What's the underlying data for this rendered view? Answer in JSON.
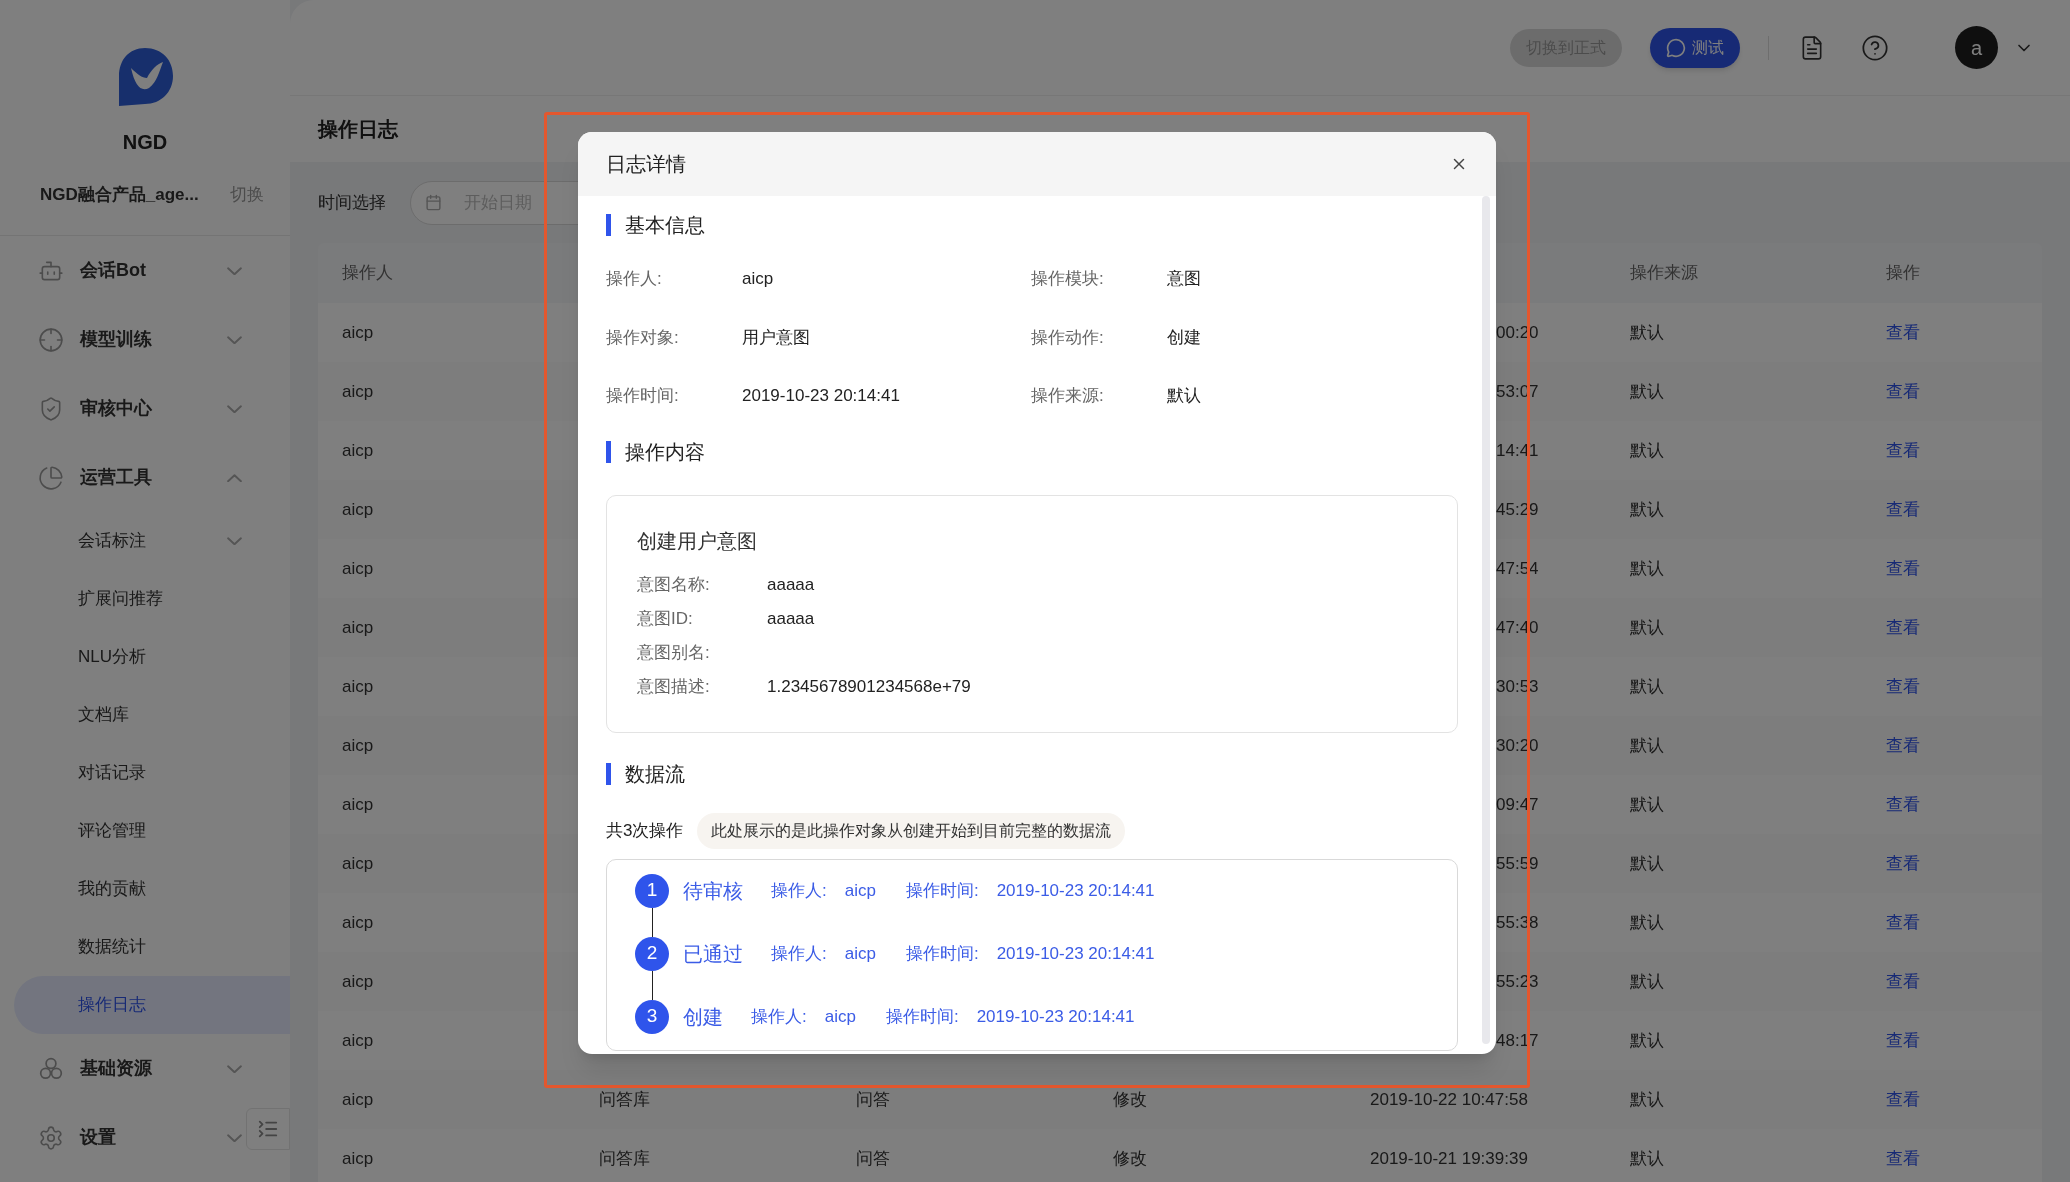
{
  "sidebar": {
    "logo_text": "NGD",
    "project": "NGD融合产品_age...",
    "switch_link": "切换",
    "menu": [
      {
        "label": "会话Bot",
        "expanded": false
      },
      {
        "label": "模型训练",
        "expanded": false
      },
      {
        "label": "审核中心",
        "expanded": false
      },
      {
        "label": "运营工具",
        "expanded": true,
        "children": [
          {
            "kind": "submenu",
            "label": "会话标注",
            "expanded": false,
            "selected": false
          },
          {
            "kind": "link",
            "label": "扩展问推荐",
            "selected": false
          },
          {
            "kind": "link",
            "label": "NLU分析",
            "selected": false
          },
          {
            "kind": "link",
            "label": "文档库",
            "selected": false
          },
          {
            "kind": "link",
            "label": "对话记录",
            "selected": false
          },
          {
            "kind": "link",
            "label": "评论管理",
            "selected": false
          },
          {
            "kind": "link",
            "label": "我的贡献",
            "selected": false
          },
          {
            "kind": "link",
            "label": "数据统计",
            "selected": false
          },
          {
            "kind": "link",
            "label": "操作日志",
            "selected": true
          }
        ]
      },
      {
        "label": "基础资源",
        "expanded": false
      },
      {
        "label": "设置",
        "expanded": false
      }
    ]
  },
  "topbar": {
    "env_button": "切换到正式",
    "test_button": "测试",
    "avatar": "a"
  },
  "page": {
    "title": "操作日志",
    "filter_label": "时间选择",
    "date_placeholder": "开始日期"
  },
  "table": {
    "columns": {
      "operator": "操作人",
      "source": "操作来源",
      "action": "操作"
    },
    "rows": [
      {
        "operator": "aicp",
        "time": "00:20",
        "source": "默认",
        "action": "查看"
      },
      {
        "operator": "aicp",
        "time": "53:07",
        "source": "默认",
        "action": "查看"
      },
      {
        "operator": "aicp",
        "time": "14:41",
        "source": "默认",
        "action": "查看"
      },
      {
        "operator": "aicp",
        "time": "45:29",
        "source": "默认",
        "action": "查看"
      },
      {
        "operator": "aicp",
        "time": "47:54",
        "source": "默认",
        "action": "查看"
      },
      {
        "operator": "aicp",
        "time": "47:40",
        "source": "默认",
        "action": "查看"
      },
      {
        "operator": "aicp",
        "time": "30:53",
        "source": "默认",
        "action": "查看"
      },
      {
        "operator": "aicp",
        "time": "30:20",
        "source": "默认",
        "action": "查看"
      },
      {
        "operator": "aicp",
        "time": "09:47",
        "source": "默认",
        "action": "查看"
      },
      {
        "operator": "aicp",
        "time": "55:59",
        "source": "默认",
        "action": "查看"
      },
      {
        "operator": "aicp",
        "time": "55:38",
        "source": "默认",
        "action": "查看"
      },
      {
        "operator": "aicp",
        "time": "55:23",
        "source": "默认",
        "action": "查看"
      },
      {
        "operator": "aicp",
        "time": "48:17",
        "source": "默认",
        "action": "查看"
      },
      {
        "operator": "aicp",
        "module": "问答库",
        "object": "问答",
        "type": "修改",
        "time": "2019-10-22 10:47:58",
        "source": "默认",
        "action": "查看"
      },
      {
        "operator": "aicp",
        "module": "问答库",
        "object": "问答",
        "type": "修改",
        "time": "2019-10-21 19:39:39",
        "source": "默认",
        "action": "查看"
      }
    ]
  },
  "modal": {
    "title": "日志详情",
    "basic": {
      "heading": "基本信息",
      "fields": [
        {
          "label": "操作人:",
          "value": "aicp"
        },
        {
          "label": "操作模块:",
          "value": "意图"
        },
        {
          "label": "操作对象:",
          "value": "用户意图"
        },
        {
          "label": "操作动作:",
          "value": "创建"
        },
        {
          "label": "操作时间:",
          "value": "2019-10-23 20:14:41"
        },
        {
          "label": "操作来源:",
          "value": "默认"
        }
      ]
    },
    "content": {
      "heading": "操作内容",
      "card_title": "创建用户意图",
      "fields": [
        {
          "label": "意图名称:",
          "value": "aaaaa"
        },
        {
          "label": "意图ID:",
          "value": "aaaaa"
        },
        {
          "label": "意图别名:"
        },
        {
          "label": "意图描述:",
          "value": "1.2345678901234568e+79"
        }
      ]
    },
    "dataflow": {
      "heading": "数据流",
      "count": "共3次操作",
      "hint": "此处展示的是此操作对象从创建开始到目前完整的数据流",
      "steps": [
        {
          "number": "1",
          "status": "待审核",
          "operator_label": "操作人:",
          "operator": "aicp",
          "time_label": "操作时间:",
          "time": "2019-10-23 20:14:41"
        },
        {
          "number": "2",
          "status": "已通过",
          "operator_label": "操作人:",
          "operator": "aicp",
          "time_label": "操作时间:",
          "time": "2019-10-23 20:14:41"
        },
        {
          "number": "3",
          "status": "创建",
          "operator_label": "操作人:",
          "operator": "aicp",
          "time_label": "操作时间:",
          "time": "2019-10-23 20:14:41"
        }
      ]
    }
  }
}
